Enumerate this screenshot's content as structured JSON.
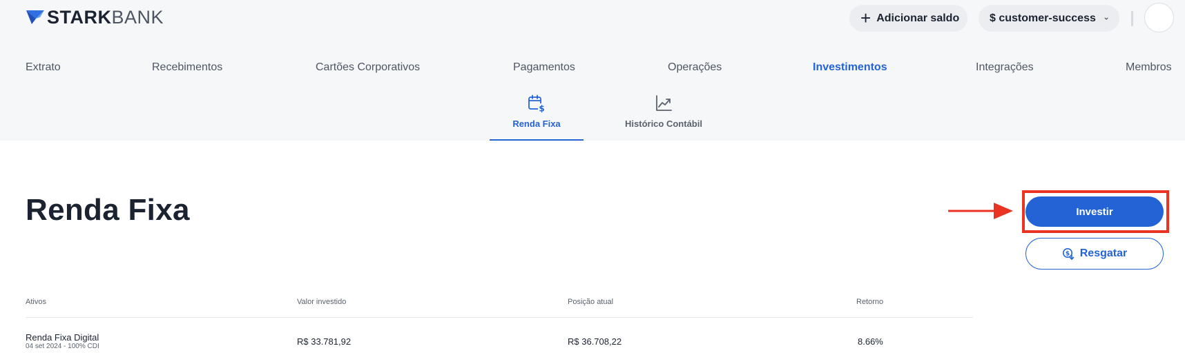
{
  "brand": {
    "name_bold": "STARK",
    "name_light": "BANK",
    "accent_color": "#2463d6",
    "logo_icon": "starkbank-logo-icon"
  },
  "header": {
    "add_balance_icon": "plus-icon",
    "add_balance_label": "Adicionar saldo",
    "workspace_label": "$ customer-success",
    "workspace_icon": "chevron-down-icon",
    "avatar_icon": "avatar"
  },
  "nav": {
    "items": [
      {
        "label": "Extrato"
      },
      {
        "label": "Recebimentos"
      },
      {
        "label": "Cartões Corporativos"
      },
      {
        "label": "Pagamentos"
      },
      {
        "label": "Operações"
      },
      {
        "label": "Investimentos",
        "active": true
      },
      {
        "label": "Integrações"
      },
      {
        "label": "Membros"
      }
    ]
  },
  "subtabs": [
    {
      "label": "Renda Fixa",
      "icon": "calendar-dollar-icon",
      "active": true
    },
    {
      "label": "Histórico Contábil",
      "icon": "line-chart-icon",
      "active": false
    }
  ],
  "page": {
    "title": "Renda Fixa",
    "invest_label": "Investir",
    "redeem_label": "Resgatar",
    "redeem_icon": "coin-down-icon",
    "annotation_color": "#ea3323"
  },
  "table": {
    "columns": [
      "Ativos",
      "Valor investido",
      "Posição atual",
      "Retorno"
    ],
    "rows": [
      {
        "name": "Renda Fixa Digital",
        "detail": "04 set 2024 - 100% CDI",
        "invested": "R$ 33.781,92",
        "current": "R$ 36.708,22",
        "return": "8.66%"
      }
    ]
  }
}
